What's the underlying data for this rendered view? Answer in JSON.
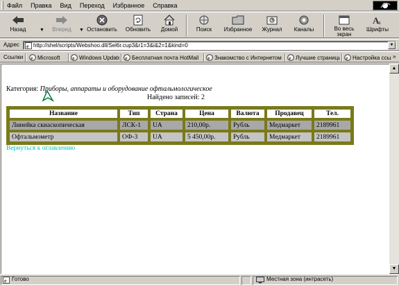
{
  "menu": [
    "Файл",
    "Правка",
    "Вид",
    "Переход",
    "Избранное",
    "Справка"
  ],
  "toolbar": {
    "back": "Назад",
    "forward": "Вперед",
    "stop": "Остановить",
    "refresh": "Обновить",
    "home": "Домой",
    "search": "Поиск",
    "favorites": "Избранное",
    "history": "Журнал",
    "channels": "Каналы",
    "fullscreen": "Во весь экран",
    "fonts": "Шрифты"
  },
  "address": {
    "label": "Адрес",
    "url": "http://shel/scripts/Webshoo.dll/Sel6r.cup3&r1=3&i&2=1&kind=0"
  },
  "links": {
    "label": "Ссылки",
    "items": [
      "Microsoft",
      "Windows Update",
      "Бесплатная почта HotMail",
      "Знакомство с Интернетом",
      "Лучшие страницы",
      "Настройка ссылок"
    ]
  },
  "page": {
    "category_label": "Категория:",
    "category_value": "Приборы, аппараты и оборудование офтальмологическое",
    "found_text": "Найдено записей: 2",
    "columns": [
      "Название",
      "Тип",
      "Страна",
      "Цена",
      "Валюта",
      "Продавец",
      "Тел."
    ],
    "rows": [
      [
        "Линейка скиаскопическая",
        "ЛСК-1",
        "UA",
        "210,00р.",
        "Рубль",
        "Медмаркет",
        "2189961"
      ],
      [
        "Офтальмометр",
        "ОФ-3",
        "UA",
        "5 450,00р.",
        "Рубль",
        "Медмаркет",
        "2189961"
      ]
    ],
    "back_link": "Вернуться к оглавлению"
  },
  "status": {
    "left": "Готово",
    "zone": "Местная зона (интрасеть)"
  }
}
